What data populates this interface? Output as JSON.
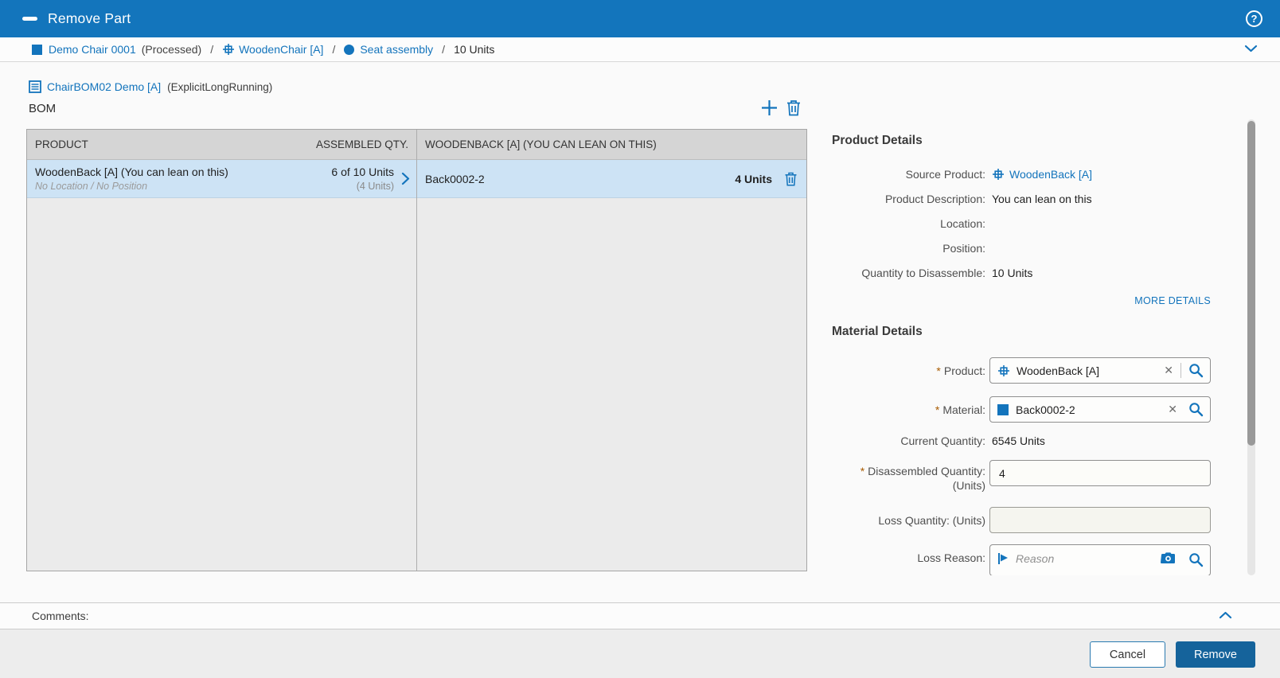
{
  "header": {
    "title": "Remove Part"
  },
  "icons": {
    "help": "?",
    "clear": "✕"
  },
  "breadcrumb": {
    "order_label": "Demo Chair 0001",
    "order_status": "(Processed)",
    "sep1": "/",
    "product_label": "WoodenChair [A]",
    "sep2": "/",
    "operation_label": "Seat assembly",
    "sep3": "/",
    "quantity_label": "10 Units"
  },
  "bom_header": {
    "link_label": "ChairBOM02 Demo [A]",
    "link_suffix": "(ExplicitLongRunning)",
    "section_title": "BOM"
  },
  "bom_table": {
    "columns": {
      "product": "PRODUCT",
      "assembled_qty": "ASSEMBLED QTY."
    },
    "row": {
      "product": "WoodenBack [A] (You can lean on this)",
      "location": "No Location / No Position",
      "assembled_qty": "6 of 10 Units",
      "assembled_qty_sub": "(4 Units)"
    }
  },
  "materials_panel": {
    "header": "WOODENBACK [A] (YOU CAN LEAN ON THIS)",
    "row": {
      "name": "Back0002-2",
      "qty": "4 Units"
    }
  },
  "product_details": {
    "title": "Product Details",
    "fields": [
      {
        "label": "Source Product:",
        "value": "WoodenBack [A]"
      },
      {
        "label": "Product Description:",
        "value": "You can lean on this"
      },
      {
        "label": "Location:",
        "value": ""
      },
      {
        "label": "Position:",
        "value": ""
      },
      {
        "label": "Quantity to Disassemble:",
        "value": "10 Units"
      }
    ],
    "more_details_label": "MORE DETAILS"
  },
  "material_details": {
    "title": "Material Details",
    "required_marker": "*",
    "product_label": "Product:",
    "product_value": "WoodenBack [A]",
    "material_label": "Material:",
    "material_value": "Back0002-2",
    "current_qty_label": "Current Quantity:",
    "current_qty_value": "6545 Units",
    "disassembled_label_line1": "Disassembled Quantity:",
    "disassembled_label_line2": "(Units)",
    "disassembled_value": "4",
    "loss_qty_label": "Loss Quantity: (Units)",
    "loss_reason_label": "Loss Reason:",
    "loss_reason_placeholder": "Reason"
  },
  "comments": {
    "label": "Comments:"
  },
  "footer": {
    "cancel_label": "Cancel",
    "remove_label": "Remove"
  },
  "colors": {
    "header_bg": "#1375BC",
    "link": "#1374BC",
    "selected_row_bg": "#CDE3F5",
    "table_header_bg": "#D5D5D5",
    "table_body_bg": "#EBEBEB",
    "primary_button_bg": "#15639B",
    "required_asterisk": "#A85A00"
  }
}
